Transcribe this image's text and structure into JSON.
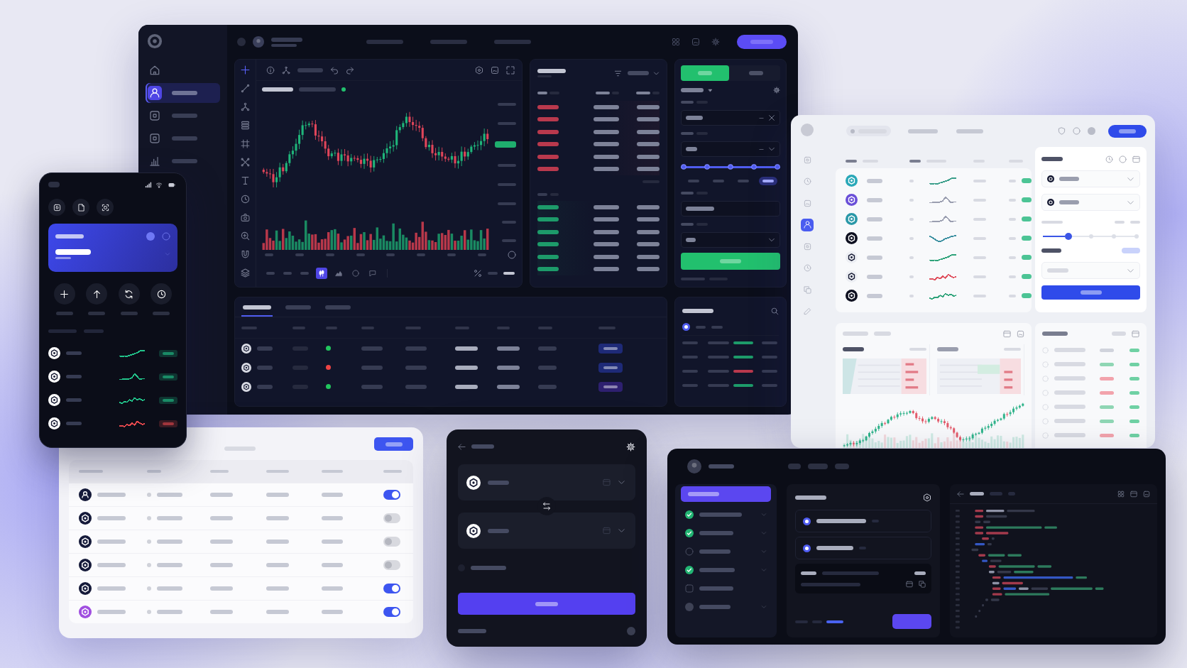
{
  "trading_window": {
    "sidebar": {
      "items": [
        {
          "kind": "home",
          "selected": false
        },
        {
          "kind": "profile",
          "selected": true
        },
        {
          "kind": "square",
          "selected": false
        },
        {
          "kind": "square",
          "selected": false
        },
        {
          "kind": "chart",
          "selected": false
        }
      ]
    },
    "chart_toolbar": {
      "buttons": [
        {
          "kind": "text",
          "selected": false
        },
        {
          "kind": "text",
          "selected": false
        },
        {
          "kind": "text",
          "selected": false
        },
        {
          "kind": "candles",
          "selected": true
        },
        {
          "kind": "area",
          "selected": false
        },
        {
          "kind": "circle",
          "selected": false
        },
        {
          "kind": "comment",
          "selected": false
        }
      ]
    },
    "order_book": {
      "rows": [
        {
          "kind": "ask"
        },
        {
          "kind": "ask"
        },
        {
          "kind": "ask"
        },
        {
          "kind": "ask"
        },
        {
          "kind": "ask"
        },
        {
          "kind": "ask"
        },
        {
          "kind": "bid"
        },
        {
          "kind": "bid"
        },
        {
          "kind": "bid"
        },
        {
          "kind": "bid"
        },
        {
          "kind": "bid"
        },
        {
          "kind": "bid"
        }
      ]
    },
    "order_form": {
      "tabs": [
        {
          "kind": "buy",
          "selected": true
        },
        {
          "kind": "sell",
          "selected": false
        }
      ],
      "leverage": {
        "level": 1,
        "steps": [
          {
            "selected": false
          },
          {
            "selected": false
          },
          {
            "selected": false
          },
          {
            "selected": true
          }
        ]
      }
    },
    "positions": {
      "tabs": [
        {
          "selected": true
        },
        {
          "selected": false
        },
        {
          "selected": false
        }
      ],
      "rows": [
        {
          "status": {
            "color": "#22c55e"
          },
          "badge": {
            "color": "#1e2a78"
          }
        },
        {
          "status": {
            "color": "#ef4444"
          },
          "badge": {
            "color": "#1e2a78"
          }
        },
        {
          "status": {
            "color": "#22c55e"
          },
          "badge": {
            "color": "#2e2070"
          }
        }
      ]
    },
    "trades": {
      "filter": {
        "checked": true
      },
      "rows": [
        {
          "kind": "buy"
        },
        {
          "kind": "buy"
        },
        {
          "kind": "sell"
        },
        {
          "kind": "buy"
        }
      ]
    }
  },
  "mobile_app": {
    "assets": [
      {
        "color": "#22c58b"
      },
      {
        "color": "#22c58b"
      },
      {
        "color": "#22c58b"
      },
      {
        "color": "#e5484d"
      }
    ]
  },
  "markets_window": {
    "nav": [
      {
        "selected": false
      },
      {
        "selected": false
      },
      {
        "selected": false
      },
      {
        "selected": true
      },
      {
        "selected": false
      },
      {
        "selected": false
      },
      {
        "selected": false
      },
      {
        "selected": false
      }
    ],
    "assets": [
      {
        "icon": {
          "color": "#2aa8b8"
        },
        "sparkline": {
          "color": "#3a9e8a"
        }
      },
      {
        "icon": {
          "color": "#6a4fd8"
        },
        "sparkline": {
          "color": "#9a9eb0"
        }
      },
      {
        "icon": {
          "color": "#2a98a8"
        },
        "sparkline": {
          "color": "#9a9eb0"
        }
      },
      {
        "icon": {
          "color": "#0e1020"
        },
        "sparkline": {
          "color": "#3a8fa0"
        }
      },
      {
        "icon": {
          "color": "#eceef3"
        },
        "sparkline": {
          "color": "#2fa37a"
        }
      },
      {
        "icon": {
          "color": "#eceef3"
        },
        "sparkline": {
          "color": "#e05260"
        }
      },
      {
        "icon": {
          "color": "#0e1020"
        },
        "sparkline": {
          "color": "#2fa37a"
        }
      }
    ],
    "order_form": {
      "slider": {
        "level": 0.27
      }
    },
    "history": {
      "rows": [
        {
          "color": "#d0d3dc"
        },
        {
          "color": "#8fd6b4"
        },
        {
          "color": "#f2a3ac"
        },
        {
          "color": "#f2a3ac"
        },
        {
          "color": "#8fd6b4"
        },
        {
          "color": "#8fd6b4"
        },
        {
          "color": "#f2a3ac"
        }
      ]
    }
  },
  "accounts_table": {
    "rows": [
      {
        "kind": "user",
        "avatar": {
          "color": "#151a3a"
        },
        "on": true
      },
      {
        "kind": "token",
        "avatar": {
          "color": "#151a3a"
        },
        "on": false
      },
      {
        "kind": "token",
        "avatar": {
          "color": "#151a3a"
        },
        "on": false
      },
      {
        "kind": "token",
        "avatar": {
          "color": "#151a3a"
        },
        "on": false
      },
      {
        "kind": "token",
        "avatar": {
          "color": "#151a3a"
        },
        "on": true
      },
      {
        "kind": "token",
        "avatar": {
          "color": "#a04ee0"
        },
        "on": true
      }
    ]
  },
  "setup_window": {
    "steps": [
      {
        "kind": "done",
        "expandable": true
      },
      {
        "kind": "done",
        "expandable": true
      },
      {
        "kind": "idle",
        "expandable": true
      },
      {
        "kind": "done",
        "expandable": true
      },
      {
        "kind": "draft",
        "expandable": false
      },
      {
        "kind": "locked",
        "expandable": true
      }
    ],
    "options": [
      {
        "checked": true
      },
      {
        "checked": true
      }
    ]
  }
}
